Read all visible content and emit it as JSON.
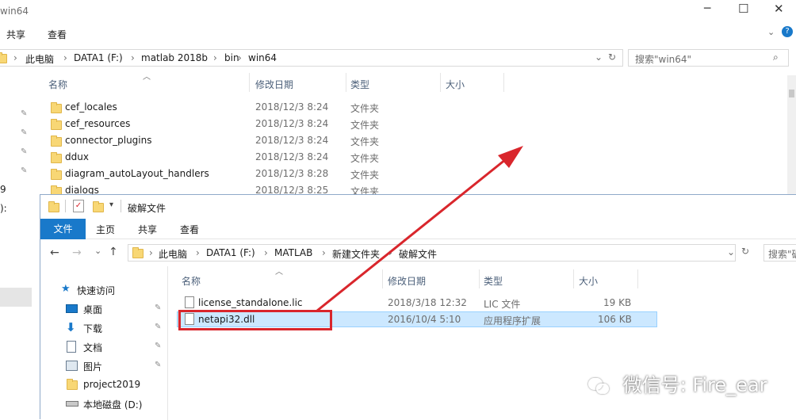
{
  "bg": {
    "title": "win64",
    "ribbon": [
      "共享",
      "查看"
    ],
    "breadcrumb": [
      "此电脑",
      "DATA1 (F:)",
      "matlab 2018b",
      "bin",
      "win64"
    ],
    "search_placeholder": "搜索\"win64\"",
    "columns": [
      "名称",
      "修改日期",
      "类型",
      "大小"
    ],
    "rows": [
      {
        "name": "cef_locales",
        "date": "2018/12/3 8:24",
        "type": "文件夹"
      },
      {
        "name": "cef_resources",
        "date": "2018/12/3 8:24",
        "type": "文件夹"
      },
      {
        "name": "connector_plugins",
        "date": "2018/12/3 8:24",
        "type": "文件夹"
      },
      {
        "name": "ddux",
        "date": "2018/12/3 8:24",
        "type": "文件夹"
      },
      {
        "name": "diagram_autoLayout_handlers",
        "date": "2018/12/3 8:28",
        "type": "文件夹"
      },
      {
        "name": "dialogs",
        "date": "2018/12/3 8:25",
        "type": "文件夹"
      }
    ],
    "left_fragments": [
      "9",
      "):"
    ]
  },
  "fg": {
    "title": "破解文件",
    "ribbon": [
      "文件",
      "主页",
      "共享",
      "查看"
    ],
    "breadcrumb": [
      "此电脑",
      "DATA1 (F:)",
      "MATLAB",
      "新建文件夹",
      "破解文件"
    ],
    "search_placeholder": "搜索\"破",
    "columns": [
      "名称",
      "修改日期",
      "类型",
      "大小"
    ],
    "rows": [
      {
        "name": "license_standalone.lic",
        "date": "2018/3/18 12:32",
        "type": "LIC 文件",
        "size": "19 KB"
      },
      {
        "name": "netapi32.dll",
        "date": "2016/10/4 5:10",
        "type": "应用程序扩展",
        "size": "106 KB"
      }
    ],
    "nav": [
      "快速访问",
      "桌面",
      "下载",
      "文档",
      "图片",
      "project2019",
      "本地磁盘 (D:)"
    ]
  },
  "watermark": "微信号: Fire_ear",
  "colors": {
    "accent": "#1979ca",
    "selection": "#cce8ff",
    "annotation": "#d9262c"
  }
}
